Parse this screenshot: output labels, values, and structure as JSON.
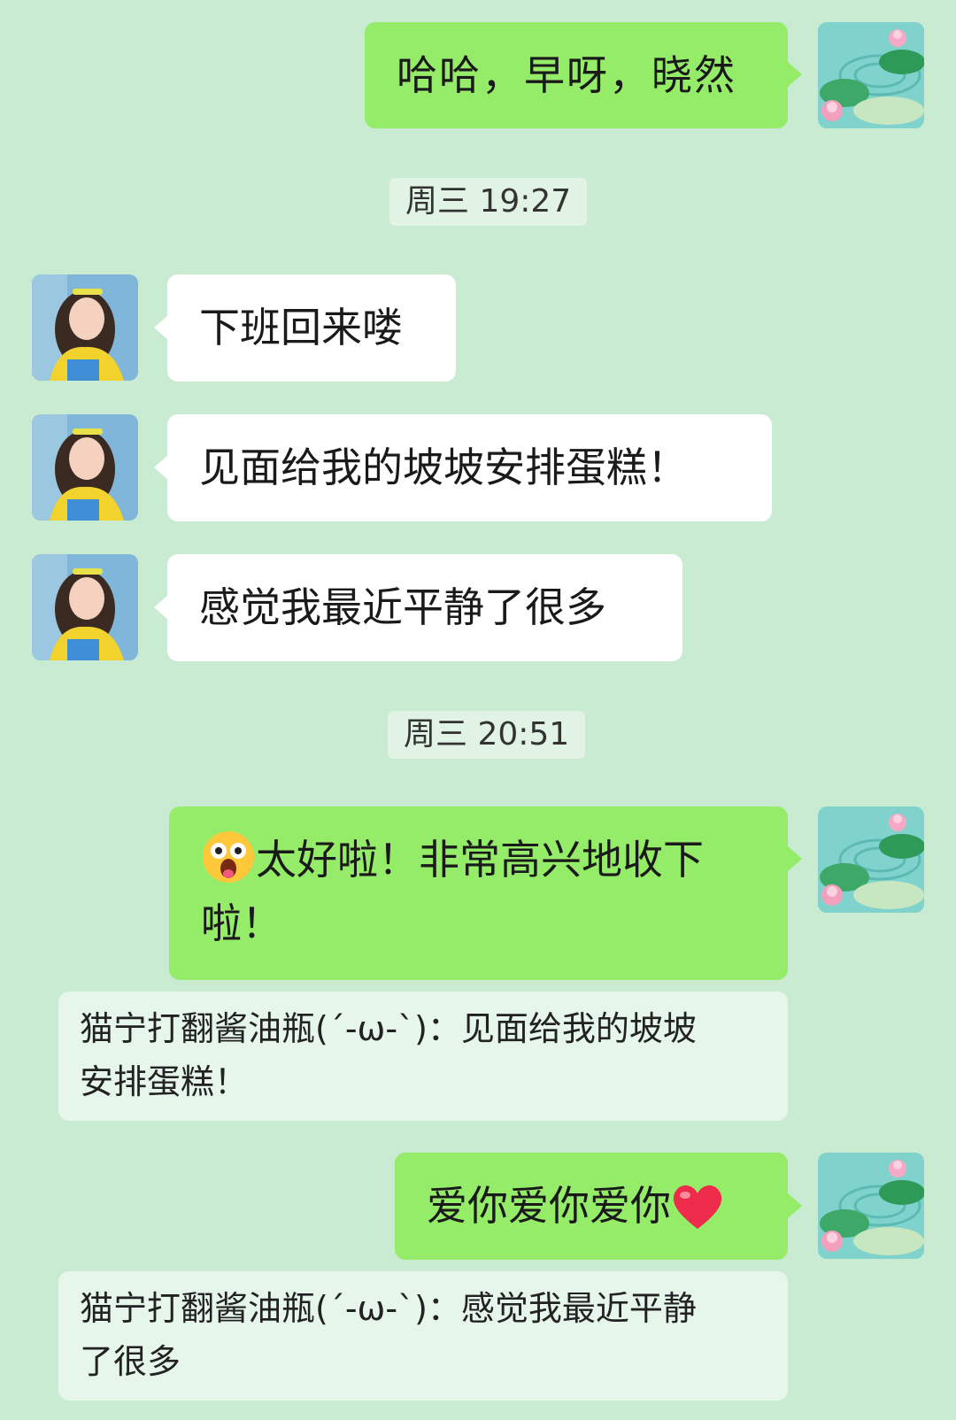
{
  "messages": [
    {
      "from": "me",
      "text": "哈哈，早呀，晓然"
    },
    {
      "timestamp": "周三 19:27"
    },
    {
      "from": "her",
      "text": "下班回来喽"
    },
    {
      "from": "her",
      "text": "见面给我的坡坡安排蛋糕！"
    },
    {
      "from": "her",
      "text": "感觉我最近平静了很多"
    },
    {
      "timestamp": "周三 20:51"
    },
    {
      "from": "me",
      "emoji": "starstruck-face-emoji",
      "text_line1": "太好啦！非常高兴地收下",
      "text_line2": "啦！"
    },
    {
      "quote_line1": "猫宁打翻酱油瓶(´-ω-`)：见面给我的坡坡",
      "quote_line2": "安排蛋糕！"
    },
    {
      "from": "me",
      "text": "爱你爱你爱你",
      "emoji": "red-heart-emoji"
    },
    {
      "quote_line1": "猫宁打翻酱油瓶(´-ω-`)：感觉我最近平静",
      "quote_line2": "了很多"
    }
  ],
  "colors": {
    "background": "#c8ebd1",
    "my_bubble": "#95ec69",
    "her_bubble": "#ffffff",
    "quote_bg": "#e6f6ea",
    "timestamp_bg": "#e0f3e5"
  }
}
